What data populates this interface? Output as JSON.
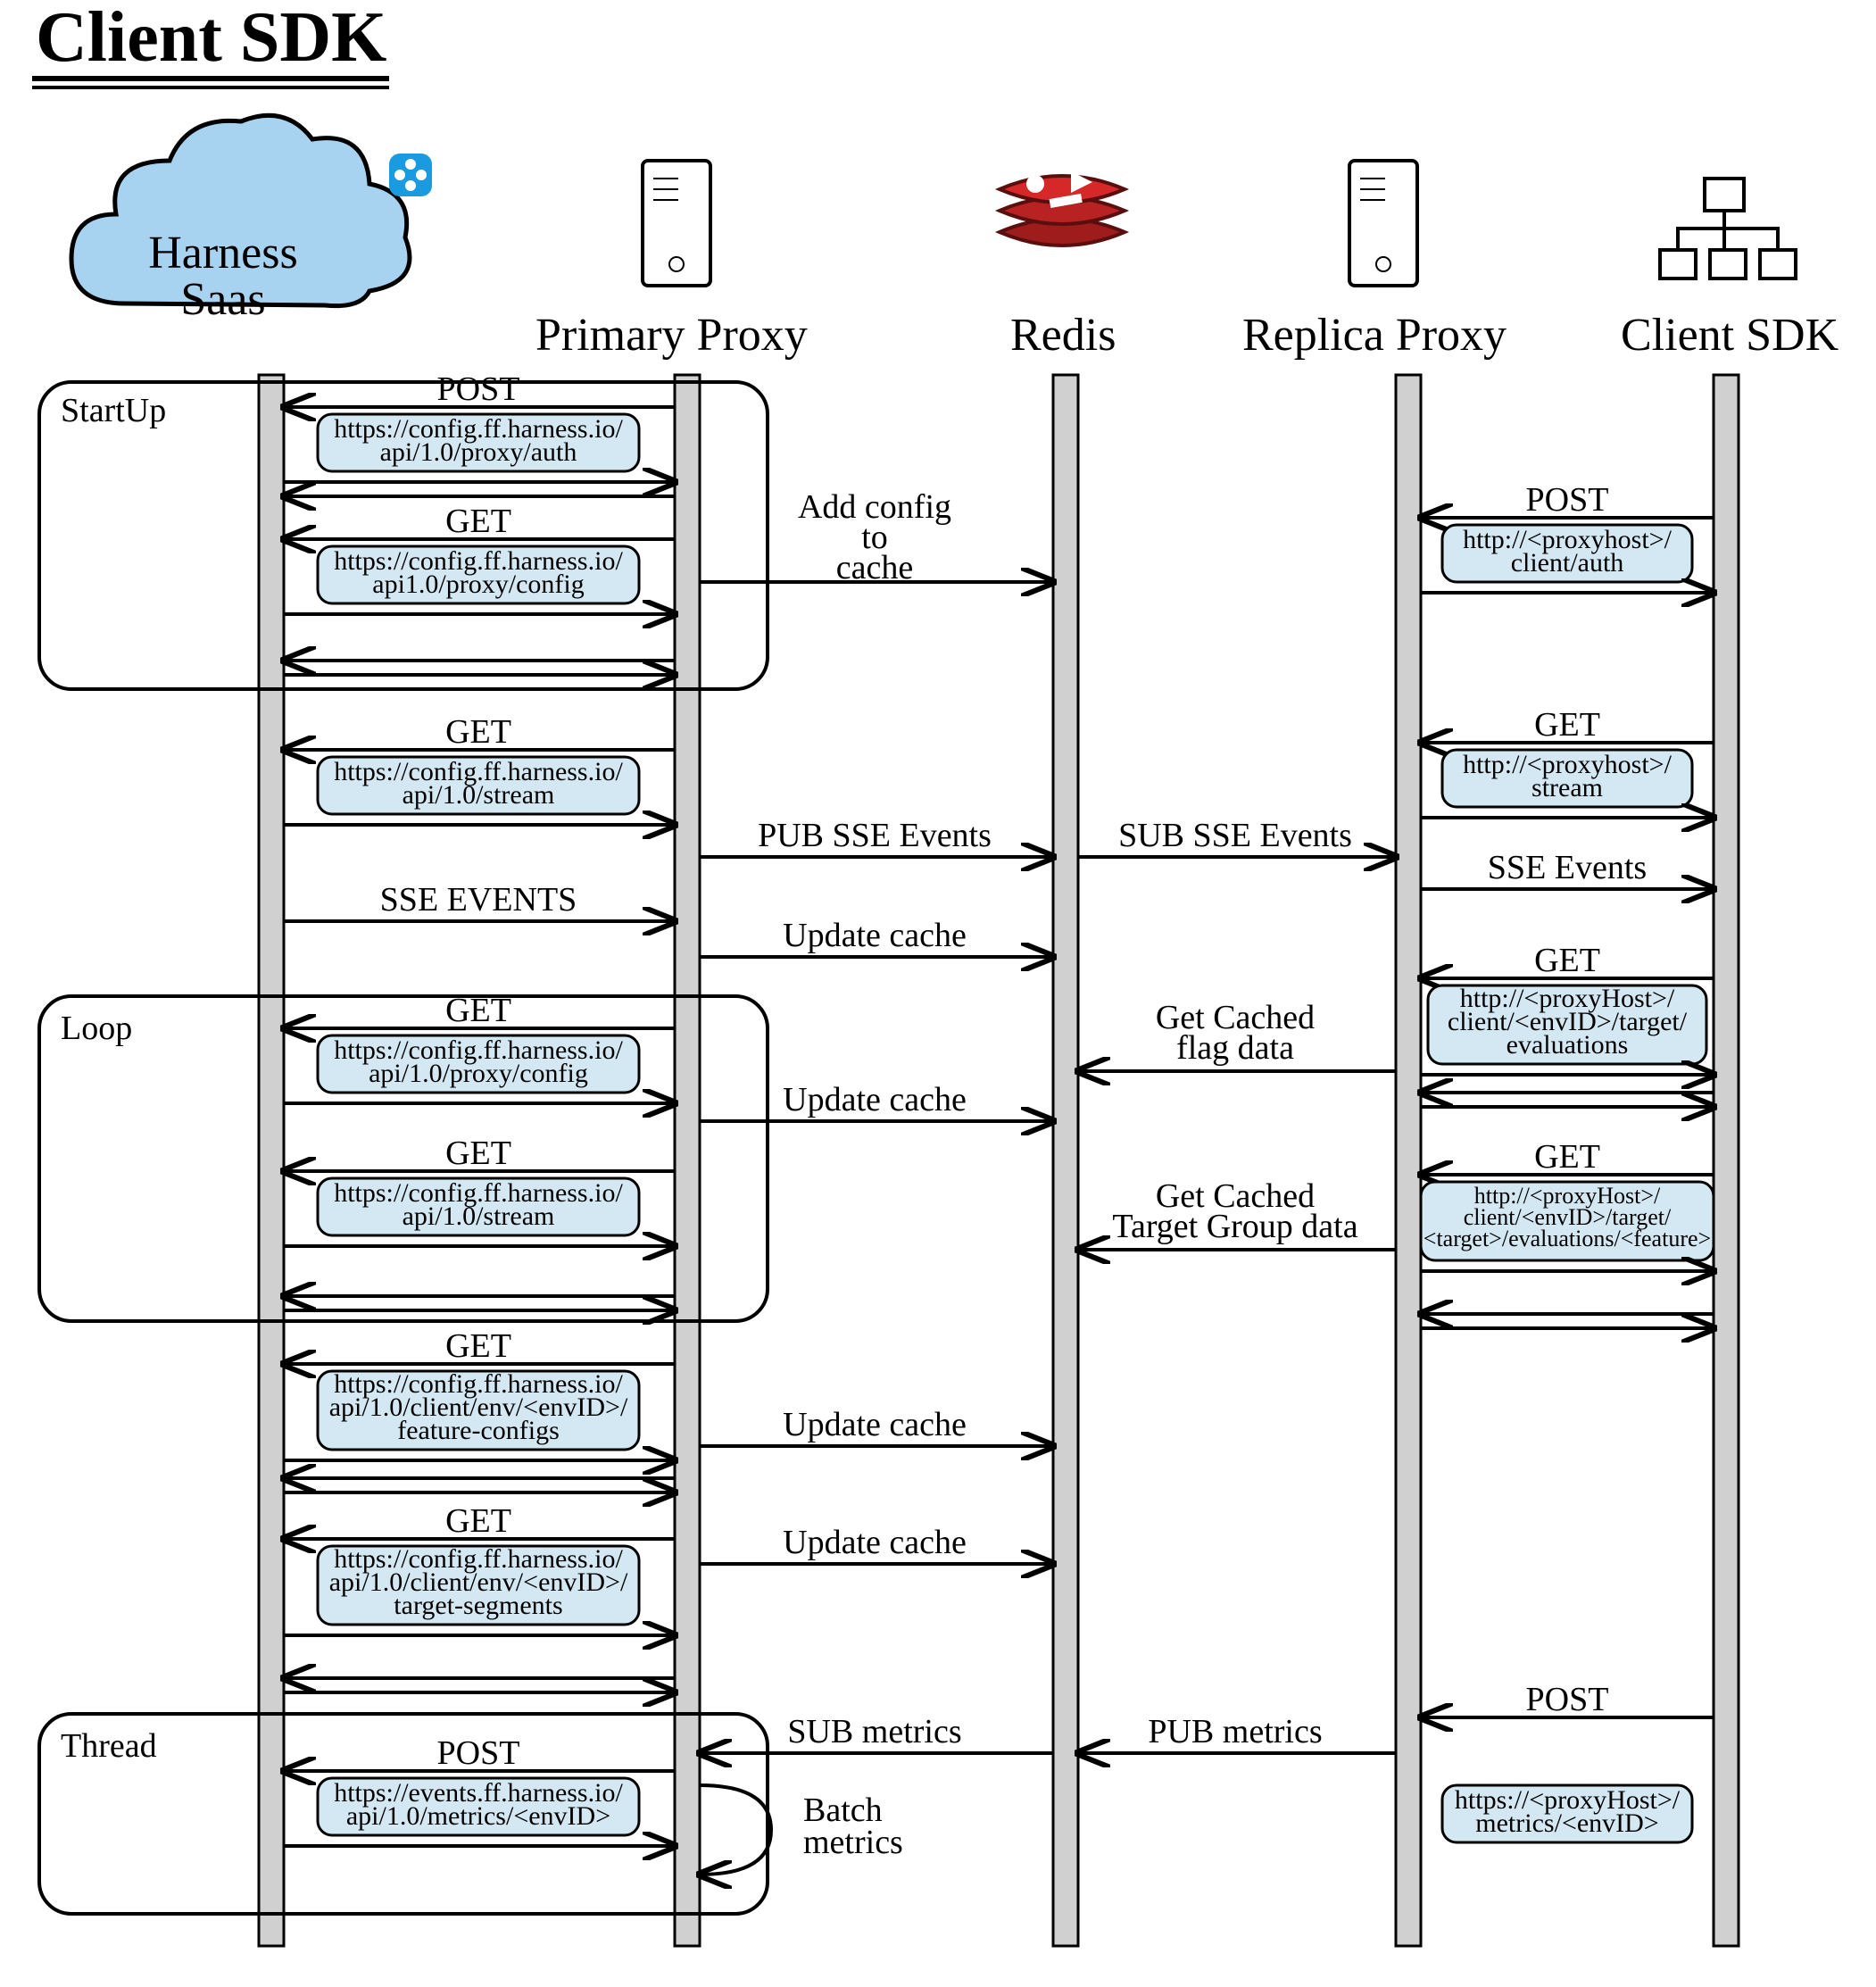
{
  "title": "Client SDK",
  "actors": {
    "saas": "Harness\nSaas",
    "primary": "Primary Proxy",
    "redis": "Redis",
    "replica": "Replica Proxy",
    "sdk": "Client SDK"
  },
  "groups": {
    "startup": "StartUp",
    "loop": "Loop",
    "thread": "Thread"
  },
  "left": {
    "m1": {
      "method": "POST",
      "url": "https://config.ff.harness.io/api/1.0/proxy/auth"
    },
    "m2": {
      "method": "GET",
      "url": "https://config.ff.harness.io/api1.0/proxy/config"
    },
    "m3": {
      "method": "GET",
      "url": "https://config.ff.harness.io/api/1.0/stream"
    },
    "sse": "SSE EVENTS",
    "m4": {
      "method": "GET",
      "url": "https://config.ff.harness.io/api/1.0/proxy/config"
    },
    "m5": {
      "method": "GET",
      "url": "https://config.ff.harness.io/api/1.0/stream"
    },
    "m6": {
      "method": "GET",
      "url": "https://config.ff.harness.io/api/1.0/client/env/<envID>/feature-configs"
    },
    "m7": {
      "method": "GET",
      "url": "https://config.ff.harness.io/api/1.0/client/env/<envID>/target-segments"
    },
    "m8": {
      "method": "POST",
      "url": "https://events.ff.harness.io/api/1.0/metrics/<envID>"
    }
  },
  "mid": {
    "addcfg": "Add config\nto\ncache",
    "pubsse": "PUB SSE Events",
    "subsse": "SUB SSE Events",
    "update": "Update cache",
    "cachedflag": "Get Cached\nflag data",
    "cachedtg": "Get Cached\nTarget Group data",
    "submetrics": "SUB metrics",
    "pubmetrics": "PUB metrics",
    "batch": "Batch\nmetrics"
  },
  "right": {
    "r1": {
      "method": "POST",
      "url": "http://<proxyhost>/client/auth"
    },
    "r2": {
      "method": "GET",
      "url": "http://<proxyhost>/stream"
    },
    "ssev": "SSE Events",
    "r3": {
      "method": "GET",
      "url": "http://<proxyHost>/client/<envID>/target/evaluations"
    },
    "r4": {
      "method": "GET",
      "url": "http://<proxyHost>/client/<envID>/target/<target>/evaluations/<feature>"
    },
    "r5": {
      "method": "POST",
      "url": "https://<proxyHost>/metrics/<envID>"
    }
  }
}
